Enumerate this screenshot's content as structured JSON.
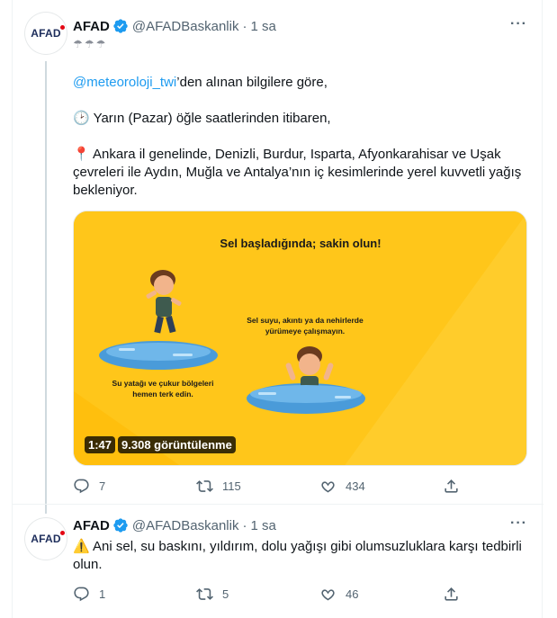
{
  "tweets": [
    {
      "avatar_text": "AFAD",
      "name": "AFAD",
      "handle": "@AFADBaskanlik",
      "separator": "·",
      "time": "1 sa",
      "more_label": "···",
      "weather_emojis": [
        "☂",
        "☂",
        "☂"
      ],
      "mention": "@meteoroloji_twi",
      "line1_rest": "’den alınan bilgilere göre,",
      "line2": "🕑 Yarın (Pazar) öğle saatlerinden itibaren,",
      "line3": "📍 Ankara il genelinde, Denizli, Burdur, Isparta, Afyonkarahisar ve Uşak çevreleri ile Aydın, Muğla ve Antalya’nın iç kesimlerinde yerel kuvvetli yağış bekleniyor.",
      "media": {
        "title": "Sel başladığında; sakin olun!",
        "caption_right_1": "Sel suyu, akıntı ya da nehirlerde",
        "caption_right_2": "yürümeye çalışmayın.",
        "caption_left_1": "Su yatağı ve çukur bölgeleri",
        "caption_left_2": "hemen terk edin.",
        "duration": "1:47",
        "views": "9.308 görüntülenme",
        "bg_color": "#ffc61a"
      },
      "replies": "7",
      "retweets": "115",
      "likes": "434"
    },
    {
      "avatar_text": "AFAD",
      "name": "AFAD",
      "handle": "@AFADBaskanlik",
      "separator": "·",
      "time": "1 sa",
      "more_label": "···",
      "text": "⚠️ Ani sel, su baskını, yıldırım, dolu yağışı gibi olumsuzluklara karşı tedbirli olun.",
      "replies": "1",
      "retweets": "5",
      "likes": "46"
    }
  ],
  "colors": {
    "accent": "#1d9bf0",
    "muted": "#536471",
    "verified": "#1d9bf0"
  }
}
